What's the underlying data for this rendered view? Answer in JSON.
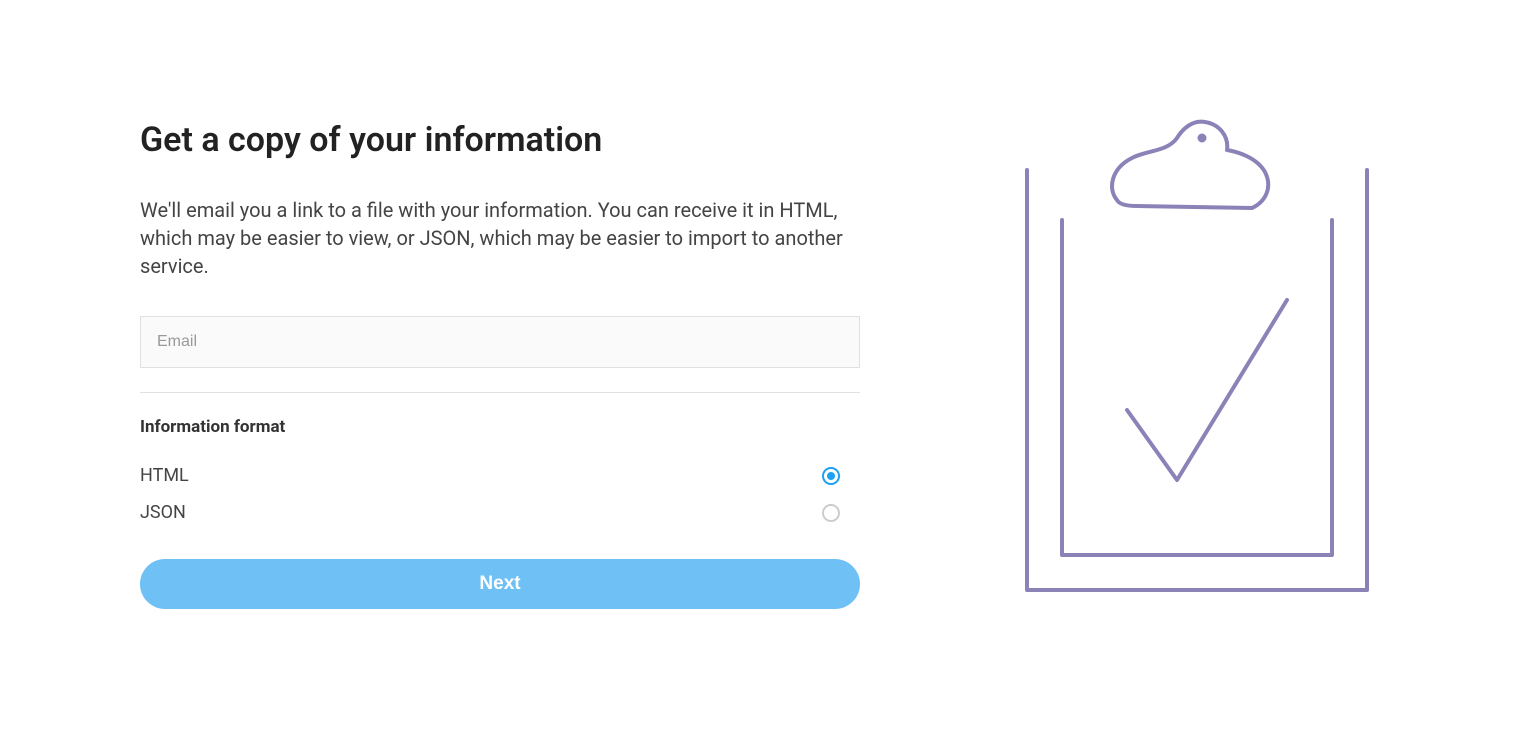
{
  "title": "Get a copy of your information",
  "description": "We'll email you a link to a file with your information. You can receive it in HTML, which may be easier to view, or JSON, which may be easier to import to another service.",
  "email": {
    "placeholder": "Email",
    "value": ""
  },
  "formatSection": {
    "label": "Information format",
    "options": [
      {
        "label": "HTML",
        "selected": true
      },
      {
        "label": "JSON",
        "selected": false
      }
    ]
  },
  "nextButton": "Next",
  "colors": {
    "accent": "#1da1f2",
    "buttonBg": "#6ec0f5",
    "iconStroke": "#8b82b8"
  }
}
